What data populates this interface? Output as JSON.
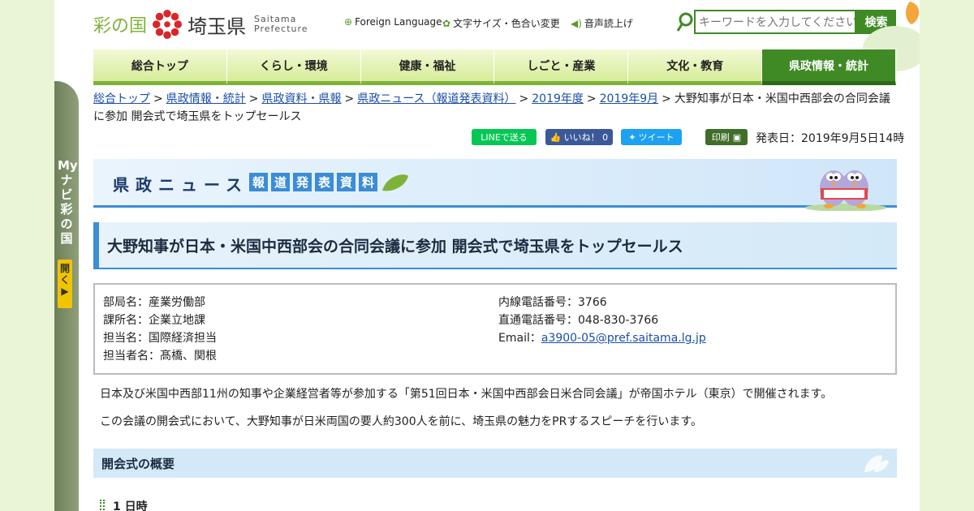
{
  "header": {
    "logo_text1": "彩の国",
    "logo_text2": "埼玉県",
    "logo_en1": "Saitama",
    "logo_en2": "Prefecture",
    "foreign_language": "Foreign Language",
    "text_size_color": "文字サイズ・色合い変更",
    "voice_reader": "音声読上げ",
    "search_placeholder": "キーワードを入力してください",
    "search_button": "検索"
  },
  "nav": {
    "items": [
      "総合トップ",
      "くらし・環境",
      "健康・福祉",
      "しごと・産業",
      "文化・教育",
      "県政情報・統計"
    ]
  },
  "side": {
    "label": "Myナビ彩の国",
    "open": "開く▶"
  },
  "breadcrumb": {
    "links": [
      "総合トップ",
      "県政情報・統計",
      "県政資料・県報",
      "県政ニュース（報道発表資料）",
      "2019年度",
      "2019年9月"
    ],
    "separator": ">",
    "current": "大野知事が日本・米国中西部会の合同会議に参加 開会式で埼玉県をトップセールス"
  },
  "share": {
    "line": "LINEで送る",
    "facebook": "いいね！ 0",
    "twitter": "ツイート",
    "print": "印刷",
    "published": "発表日：2019年9月5日14時"
  },
  "banner": {
    "title": "県政ニュース",
    "sub_chars": [
      "報",
      "道",
      "発",
      "表",
      "資",
      "料"
    ]
  },
  "page_title": "大野知事が日本・米国中西部会の合同会議に参加 開会式で埼玉県をトップセールス",
  "info": {
    "left": [
      "部局名：産業労働部",
      "課所名：企業立地課",
      "担当名：国際経済担当",
      "担当者名：髙橋、関根"
    ],
    "right": [
      "内線電話番号：3766",
      "直通電話番号：048-830-3766"
    ],
    "email_label": "Email：",
    "email": "a3900-05@pref.saitama.lg.jp"
  },
  "body": {
    "p1": "日本及び米国中西部11州の知事や企業経営者等が参加する「第51回日本・米国中西部会日米合同会議」が帝国ホテル（東京）で開催されます。",
    "p2": "この会議の開会式において、大野知事が日米両国の要人約300人を前に、埼玉県の魅力をPRするスピーチを行います。",
    "section": "開会式の概要",
    "sub1": "1 日時"
  },
  "colors": {
    "brand_green": "#3f8a25",
    "nav_light": "#d6ec99",
    "accent_blue": "#3b8dd6",
    "line_green": "#06c755",
    "fb_blue": "#3b5998",
    "tw_blue": "#1da1f2"
  }
}
